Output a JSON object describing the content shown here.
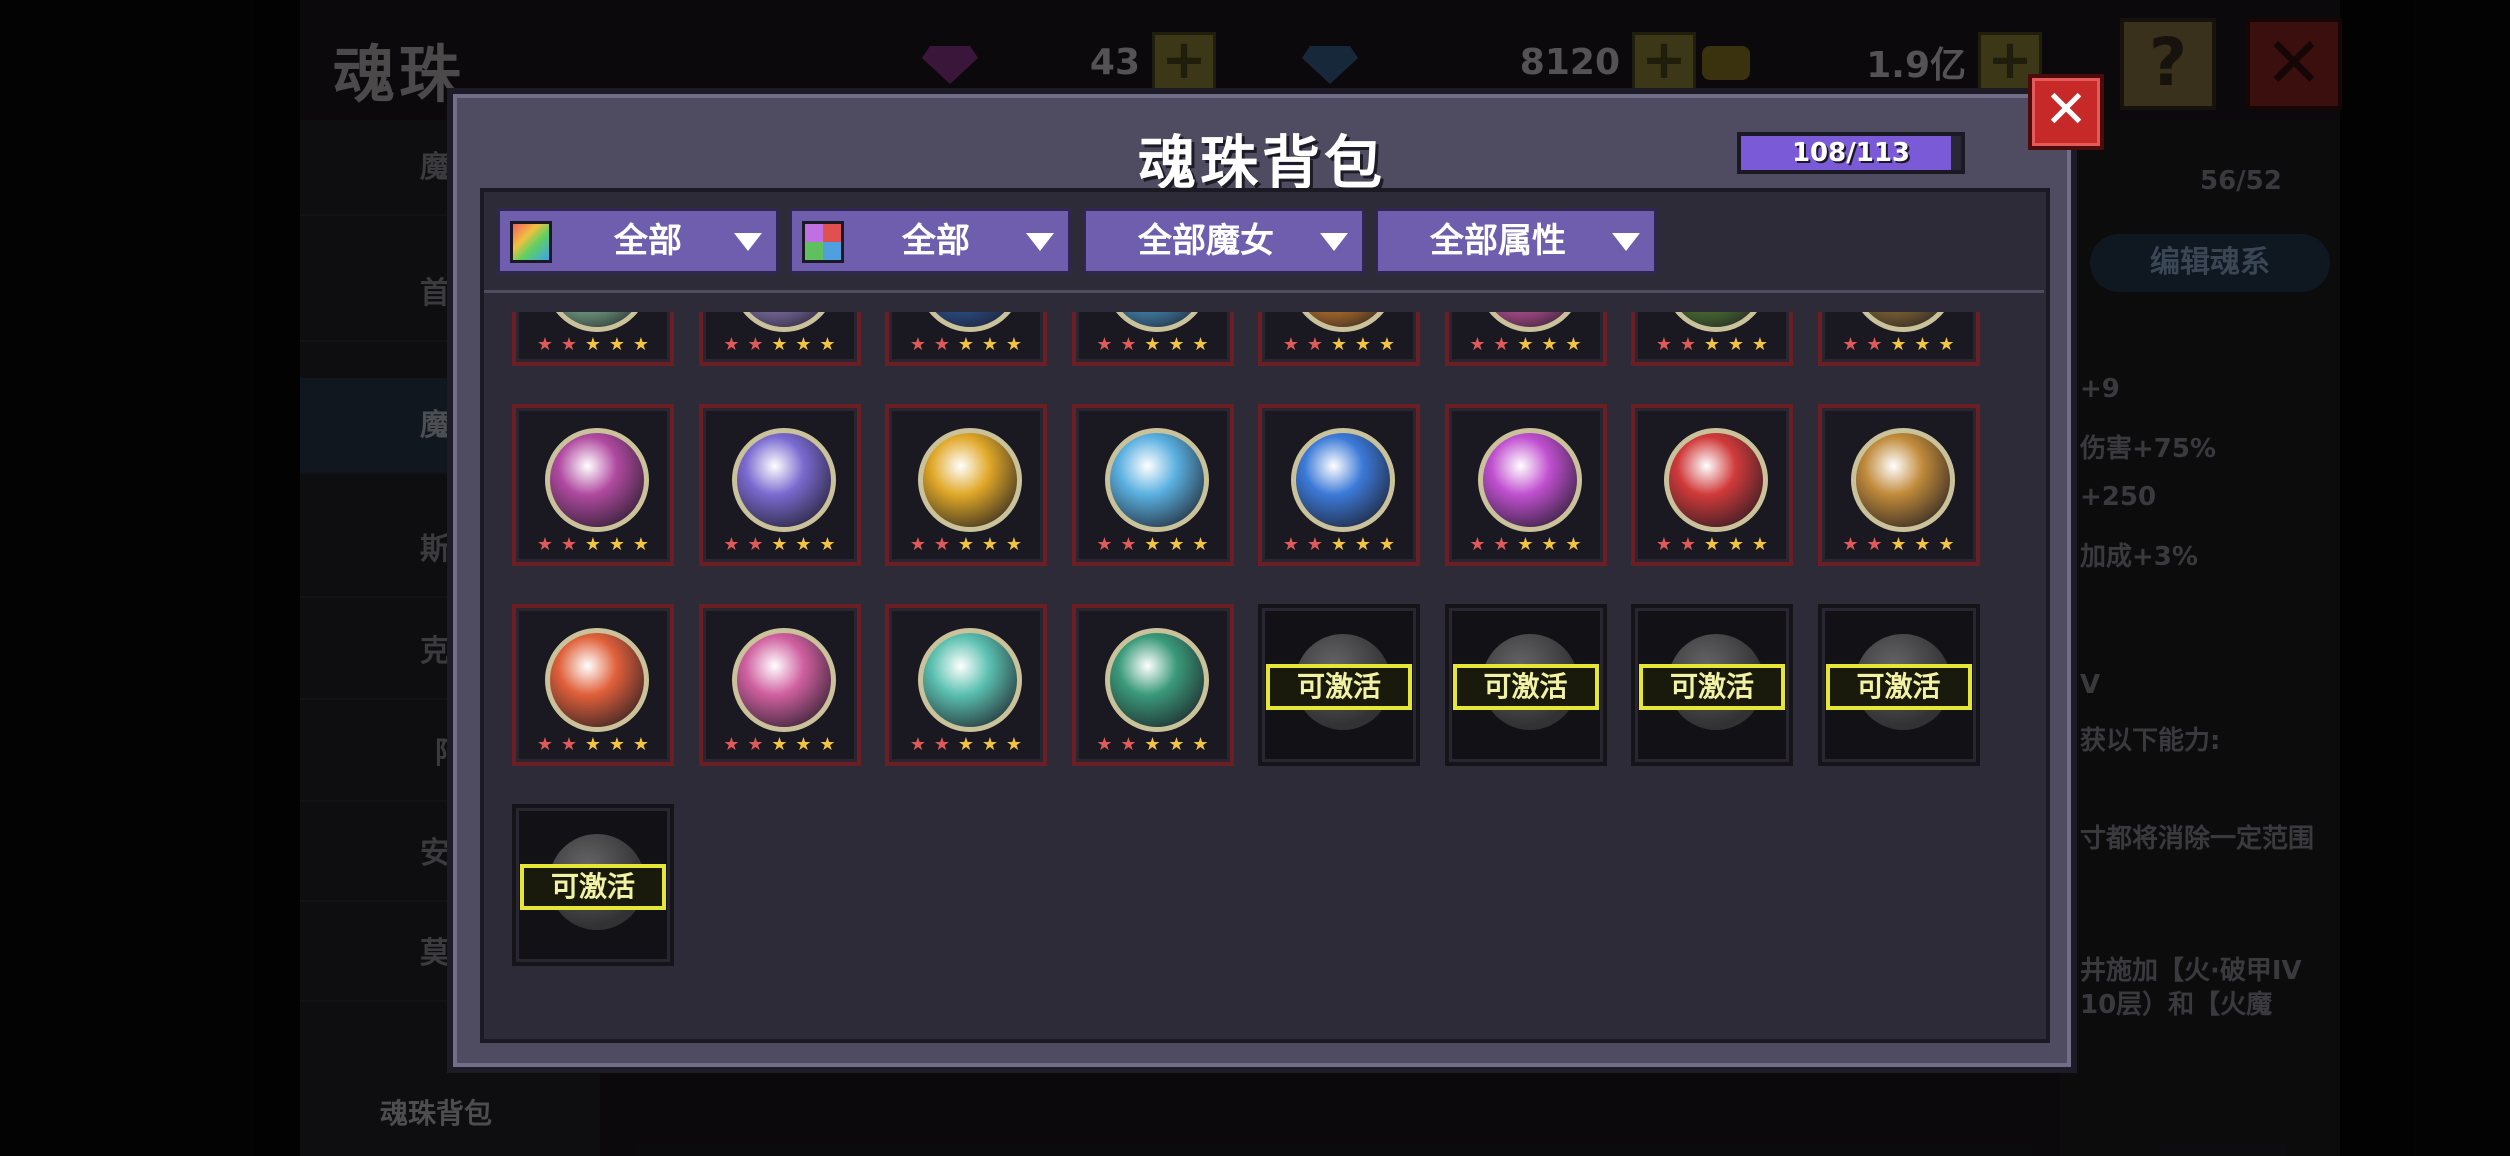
{
  "background": {
    "title": "魂珠",
    "resources": [
      {
        "icon": "purple-gem-icon",
        "value": "43"
      },
      {
        "icon": "blue-gem-icon",
        "value": "8120"
      },
      {
        "icon": "gold-coin-icon",
        "value": "1.9亿"
      }
    ],
    "help_label": "?",
    "close_label": "✕",
    "sidebar_items": [
      "魔物",
      "首领",
      "魔神",
      "斯扌",
      "克罗",
      "阿",
      "安木",
      "莫批"
    ],
    "sidebar_bottom": "魂珠背包",
    "right_panel": {
      "level": "56/52",
      "button": "编辑魂系",
      "lines": [
        "+9",
        "伤害+75%",
        "+250",
        "加成+3%",
        "V",
        "获以下能力:",
        "寸都将消除一定范围",
        "井施加【火·破甲IV",
        "10层）和【火魔"
      ]
    }
  },
  "modal": {
    "title": "魂珠背包",
    "capacity": "108/113",
    "capacity_fraction": 0.956,
    "close_label": "✕",
    "filters": [
      {
        "label": "全部",
        "icon": "rainbow-filter-icon"
      },
      {
        "label": "全部",
        "icon": "color-grid-filter-icon"
      },
      {
        "label": "全部魔女"
      },
      {
        "label": "全部属性"
      }
    ],
    "activate_label": "可激活",
    "colors": {
      "accent": "#6f5dad",
      "cell_border": "#6b1f24",
      "star_red": "#e05a5a",
      "star_gold": "#f3c342",
      "activate": "#e6e636"
    },
    "rows": [
      [
        {
          "icon": "green-lotus-orb-icon",
          "color": "#8fc9a3",
          "stars": "2red-3gold"
        },
        {
          "icon": "star-crest-orb-icon",
          "color": "#9a86c9",
          "stars": "2red-3gold"
        },
        {
          "icon": "blue-moon-orb-icon",
          "color": "#2f5fa8",
          "stars": "2red-3gold"
        },
        {
          "icon": "sky-star-orb-icon",
          "color": "#4fa3d9",
          "stars": "2red-3gold"
        },
        {
          "icon": "fire-demon-orb-icon",
          "color": "#e08a2e",
          "stars": "2red-3gold"
        },
        {
          "icon": "pink-heart-orb-icon",
          "color": "#e05fb0",
          "stars": "2red-3gold"
        },
        {
          "icon": "forest-beast-orb-icon",
          "color": "#5a8a3a",
          "stars": "2red-3gold"
        },
        {
          "icon": "earth-beast-orb-icon",
          "color": "#a07a3a",
          "stars": "2red-3gold"
        }
      ],
      [
        {
          "icon": "purple-crystal-orb-icon",
          "color": "#b04aa0",
          "stars": "2red-3gold"
        },
        {
          "icon": "violet-crystal-orb-icon",
          "color": "#7a6ad0",
          "stars": "2red-3gold"
        },
        {
          "icon": "golden-armor-orb-icon",
          "color": "#e0a828",
          "stars": "2red-3gold"
        },
        {
          "icon": "ice-golem-orb-icon",
          "color": "#5ab0e0",
          "stars": "2red-3gold"
        },
        {
          "icon": "blue-sphere-orb-icon",
          "color": "#3c7ad8",
          "stars": "2red-3gold"
        },
        {
          "icon": "pink-sphere-orb-icon",
          "color": "#c050d0",
          "stars": "2red-3gold"
        },
        {
          "icon": "warrior-blade-orb-icon",
          "color": "#d03a3a",
          "stars": "2red-3gold"
        },
        {
          "icon": "monkey-king-orb-icon",
          "color": "#c08a3a",
          "stars": "2red-3gold"
        }
      ],
      [
        {
          "icon": "flame-mask-orb-icon",
          "color": "#e0603a",
          "stars": "2red-3gold"
        },
        {
          "icon": "heart-mask-orb-icon",
          "color": "#d060a0",
          "stars": "2red-3gold"
        },
        {
          "icon": "cyan-gem-orb-icon",
          "color": "#5ac0b0",
          "stars": "2red-3gold"
        },
        {
          "icon": "emerald-gem-orb-icon",
          "color": "#3a9a7a",
          "stars": "2red-3gold"
        },
        {
          "icon": "locked-orb-icon",
          "locked": true
        },
        {
          "icon": "locked-orb-icon",
          "locked": true
        },
        {
          "icon": "locked-orb-icon",
          "locked": true
        },
        {
          "icon": "locked-orb-icon",
          "locked": true
        }
      ],
      [
        {
          "icon": "locked-orb-icon",
          "locked": true
        }
      ]
    ]
  }
}
